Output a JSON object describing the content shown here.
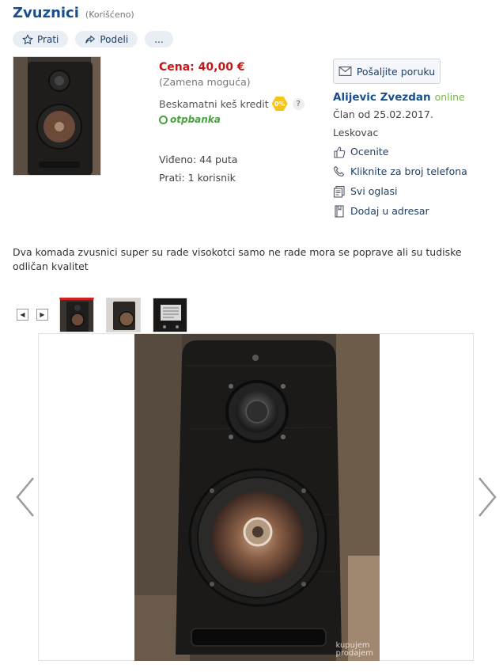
{
  "listing": {
    "title": "Zvuznici",
    "condition": "(Korišćeno)"
  },
  "actions": {
    "follow": "Prati",
    "share": "Podeli",
    "more": "..."
  },
  "info": {
    "price": "Cena: 40,00 €",
    "swap": "(Zamena moguća)",
    "credit": "Beskamatni keš kredit",
    "credit_badge": "0%",
    "credit_help": "?",
    "bank": "otpbanka",
    "views": "Viđeno: 44 puta",
    "followers": "Prati: 1 korisnik"
  },
  "seller": {
    "message_button": "Pošaljite poruku",
    "name": "Alijevic Zvezdan",
    "status": "online",
    "member_since": "Član od 25.02.2017.",
    "city": "Leskovac",
    "links": {
      "rate": "Ocenite",
      "phone": "Kliknite za broj telefona",
      "all_ads": "Svi oglasi",
      "address_book": "Dodaj u adresar"
    }
  },
  "description": "Dva komada zvusnici super su rade visokotci samo ne rade mora se poprave ali su tudiske odličan kvalitet",
  "gallery": {
    "prev_small": "◀",
    "next_small": "▶",
    "thumbnails": [
      "speaker-front",
      "speaker-side",
      "speaker-back"
    ],
    "watermark_line1": "kupujem",
    "watermark_line2": "prodajem"
  },
  "colors": {
    "title": "#1a4f8b",
    "price": "#c01818",
    "online": "#7ab648",
    "bank": "#48a23f",
    "badge": "#f6c31a"
  }
}
